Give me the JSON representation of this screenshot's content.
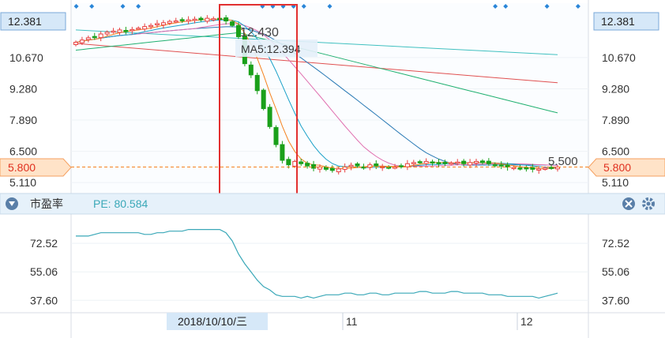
{
  "main_chart": {
    "y_ticks": [
      "10.670",
      "9.280",
      "7.890",
      "6.500",
      "5.110"
    ],
    "ylim": [
      4.8,
      12.6
    ],
    "top_value": "12.381",
    "current_price": "5.800",
    "hover_value": "12.430",
    "ma_label": "MA5:12.394",
    "last_value": "5.500"
  },
  "pe_panel": {
    "title": "市盈率",
    "pe_label": "PE: 80.584",
    "y_ticks": [
      "72.52",
      "55.06",
      "37.60"
    ],
    "ylim": [
      30,
      90
    ]
  },
  "x_axis": {
    "highlight_date": "2018/10/10/三",
    "month_ticks": [
      "11",
      "12"
    ]
  },
  "colors": {
    "up": "#e84040",
    "down": "#1aa01a",
    "ma5": "#f5821f",
    "ma10": "#1aa0c8",
    "ma20": "#e070b0",
    "ma30": "#2a7ab5",
    "ma60": "#20b070",
    "ma120": "#e05050",
    "ma250": "#40c0c0",
    "pe_line": "#3aa8b8",
    "highlight_box": "#e23030",
    "price_tag": "#ffe3c8"
  },
  "icons": {
    "collapse": "chevron-down-icon",
    "close": "close-icon",
    "settings": "gear-icon",
    "markers": "diamond-icon"
  },
  "chart_data": {
    "type": "candlestick",
    "closes": [
      11.35,
      11.45,
      11.55,
      11.6,
      11.72,
      11.8,
      11.85,
      11.9,
      11.85,
      11.92,
      11.98,
      12.05,
      12.1,
      12.18,
      12.22,
      12.28,
      12.3,
      12.33,
      12.35,
      12.38,
      12.35,
      12.42,
      12.4,
      12.38,
      12.3,
      12.1,
      11.6,
      10.4,
      9.9,
      9.2,
      8.4,
      7.6,
      6.8,
      6.1,
      5.9,
      6.05,
      5.95,
      5.85,
      5.75,
      5.8,
      5.7,
      5.65,
      5.72,
      5.8,
      5.88,
      5.85,
      5.78,
      5.9,
      5.85,
      5.82,
      5.78,
      5.8,
      5.85,
      5.95,
      6.0,
      6.02,
      6.05,
      5.98,
      5.95,
      6.0,
      5.98,
      6.02,
      5.95,
      6.0,
      6.05,
      6.0,
      5.95,
      5.9,
      5.85,
      5.8,
      5.78,
      5.75,
      5.72,
      5.7,
      5.72,
      5.75,
      5.78,
      5.8
    ],
    "pe": [
      77,
      77,
      77,
      78,
      79,
      79,
      79,
      79,
      79,
      79,
      79,
      78,
      78,
      79,
      79,
      80,
      80,
      80,
      81,
      81,
      81,
      81,
      81,
      81,
      79,
      74,
      66,
      60,
      55,
      50,
      46,
      44,
      41,
      40,
      40,
      40,
      39,
      40,
      39,
      40,
      41,
      41,
      41,
      42,
      42,
      41,
      41,
      42,
      42,
      41,
      41,
      42,
      42,
      42,
      42,
      43,
      43,
      42,
      42,
      42,
      43,
      43,
      42,
      42,
      42,
      42,
      41,
      41,
      41,
      40,
      40,
      40,
      40,
      40,
      39,
      40,
      41,
      42
    ]
  }
}
